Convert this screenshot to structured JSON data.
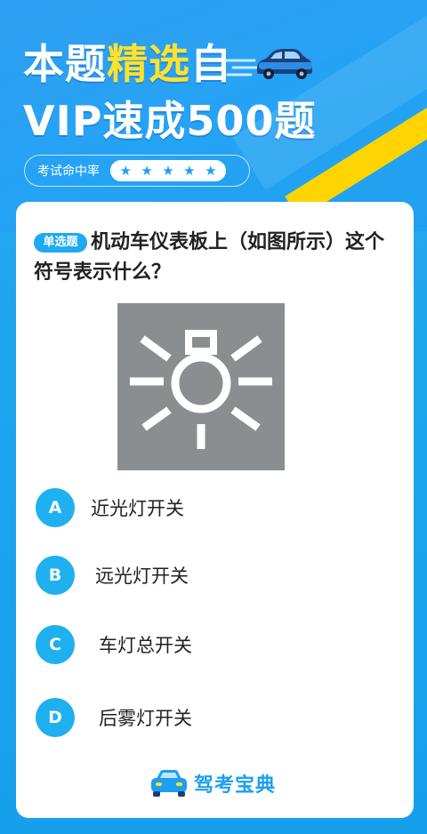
{
  "header": {
    "title_part1": "本题",
    "title_highlight": "精选",
    "title_part2": "自",
    "title_line2": "VIP速成500题",
    "hit_rate_label": "考试命中率",
    "hit_rate_stars": 5
  },
  "question": {
    "tag": "单选题",
    "text": "机动车仪表板上（如图所示）这个符号表示什么？",
    "image_icon": "headlight-symbol-icon"
  },
  "options": [
    {
      "letter": "A",
      "text": "近光灯开关"
    },
    {
      "letter": "B",
      "text": "远光灯开关"
    },
    {
      "letter": "C",
      "text": "车灯总开关"
    },
    {
      "letter": "D",
      "text": "后雾灯开关"
    }
  ],
  "brand": {
    "name": "驾考宝典",
    "icon": "car-logo-icon"
  },
  "colors": {
    "accent": "#1eaaf0",
    "highlight": "#ffe22e",
    "symbol_bg": "#8b8e91"
  }
}
